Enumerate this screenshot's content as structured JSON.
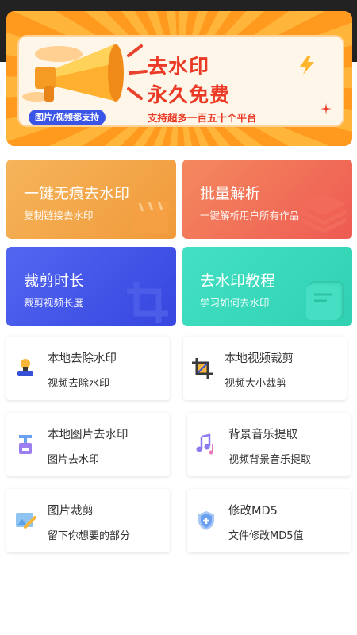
{
  "banner": {
    "title_line1": "去水印",
    "title_line2": "永久免费",
    "subtitle": "支持超多一百五十个平台",
    "pill": "图片/视频都支持"
  },
  "tiles": [
    {
      "title": "一键无痕去水印",
      "subtitle": "复制链接去水印",
      "icon": "clapperboard-icon"
    },
    {
      "title": "批量解析",
      "subtitle": "一键解析用户所有作品",
      "icon": "layers-icon"
    },
    {
      "title": "裁剪时长",
      "subtitle": "裁剪视频长度",
      "icon": "crop-icon"
    },
    {
      "title": "去水印教程",
      "subtitle": "学习如何去水印",
      "icon": "book-icon"
    }
  ],
  "cards": [
    {
      "title": "本地去除水印",
      "subtitle": "视频去除水印",
      "icon": "stamp-icon"
    },
    {
      "title": "本地视频裁剪",
      "subtitle": "视频大小裁剪",
      "icon": "crop-icon"
    },
    {
      "title": "本地图片去水印",
      "subtitle": "图片去水印",
      "icon": "image-stamp-icon"
    },
    {
      "title": "背景音乐提取",
      "subtitle": "视频背景音乐提取",
      "icon": "music-icon"
    },
    {
      "title": "图片裁剪",
      "subtitle": "留下你想要的部分",
      "icon": "image-edit-icon"
    },
    {
      "title": "修改MD5",
      "subtitle": "文件修改MD5值",
      "icon": "shield-plus-icon"
    }
  ],
  "colors": {
    "banner_accent": "#ea3a26",
    "pill": "#3a54e8",
    "tile_orange": "#f09a3a",
    "tile_red": "#ee5a52",
    "tile_blue": "#3646df",
    "tile_teal": "#2fd1b2"
  }
}
